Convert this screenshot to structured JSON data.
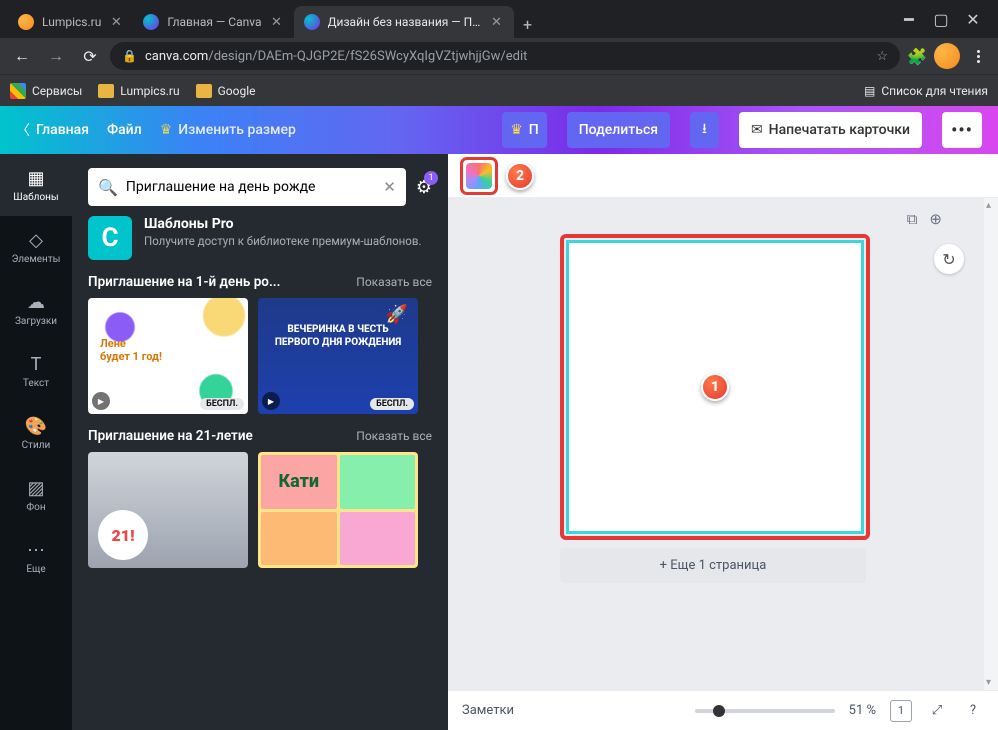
{
  "browser": {
    "tabs": [
      {
        "title": "Lumpics.ru",
        "favicon": "orange",
        "active": false
      },
      {
        "title": "Главная — Canva",
        "favicon": "canva",
        "active": false
      },
      {
        "title": "Дизайн без названия — Пригл",
        "favicon": "canva",
        "active": true
      }
    ],
    "url_host": "canva.com",
    "url_path": "/design/DAEm-QJGP2E/fS26SWcyXqIgVZtjwhjjGw/edit",
    "bookmarks": {
      "apps": "Сервисы",
      "items": [
        "Lumpics.ru",
        "Google"
      ],
      "reading_list": "Список для чтения"
    }
  },
  "header": {
    "home": "Главная",
    "file": "Файл",
    "resize": "Изменить размер",
    "pro_short": "П",
    "share": "Поделиться",
    "print": "Напечатать карточки"
  },
  "rail": {
    "templates": "Шаблоны",
    "elements": "Элементы",
    "uploads": "Загрузки",
    "text": "Текст",
    "styles": "Стили",
    "background": "Фон",
    "more": "Еще"
  },
  "panel": {
    "search_value": "Приглашение на день рожде",
    "filter_count": "1",
    "pro": {
      "title": "Шаблоны Pro",
      "desc": "Получите доступ к библиотеке премиум-шаблонов."
    },
    "section1": {
      "title": "Приглашение на 1-й день ро...",
      "all": "Показать все",
      "t1_line1": "Лене",
      "t1_line2": "будет 1 год!",
      "t2_text": "ВЕЧЕРИНКА В ЧЕСТЬ ПЕРВОГО ДНЯ РОЖДЕНИЯ",
      "free": "БЕСПЛ."
    },
    "section2": {
      "title": "Приглашение на 21-летие",
      "all": "Показать все",
      "big21": "21!",
      "kati": "Кати"
    }
  },
  "canvas": {
    "add_page": "+ Еще 1 страница",
    "notes": "Заметки",
    "zoom": "51 %",
    "page_indicator": "1"
  },
  "annotations": {
    "one": "1",
    "two": "2"
  }
}
